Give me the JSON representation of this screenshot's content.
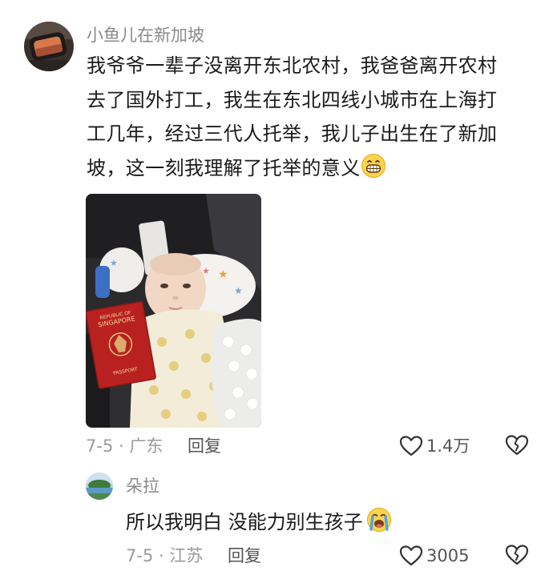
{
  "comment": {
    "username": "小鱼儿在新加坡",
    "lines": [
      "我爷爷一辈子没离开东北农村，我爸爸离开农村",
      "去了国外打工，我生在东北四线小城市在上海打",
      "工几年，经过三代人托举，我儿子出生在了新加",
      "坡，这一刻我理解了托举的意义"
    ],
    "emoji": "grinning-face-emoji",
    "photo": {
      "passport_country_1": "REPUBLIC OF",
      "passport_country_2": "SINGAPORE",
      "passport_label": "PASSPORT"
    },
    "date_location": "7-5 · 广东",
    "reply_label": "回复",
    "like_count": "1.4万"
  },
  "reply": {
    "username": "朵拉",
    "text": "所以我明白 没能力别生孩子",
    "emoji": "loudly-crying-face-emoji",
    "date_location": "7-5 · 江苏",
    "reply_label": "回复",
    "like_count": "3005"
  },
  "colors": {
    "passport_red": "#b8211f",
    "muted_text": "#9a9a9a"
  }
}
